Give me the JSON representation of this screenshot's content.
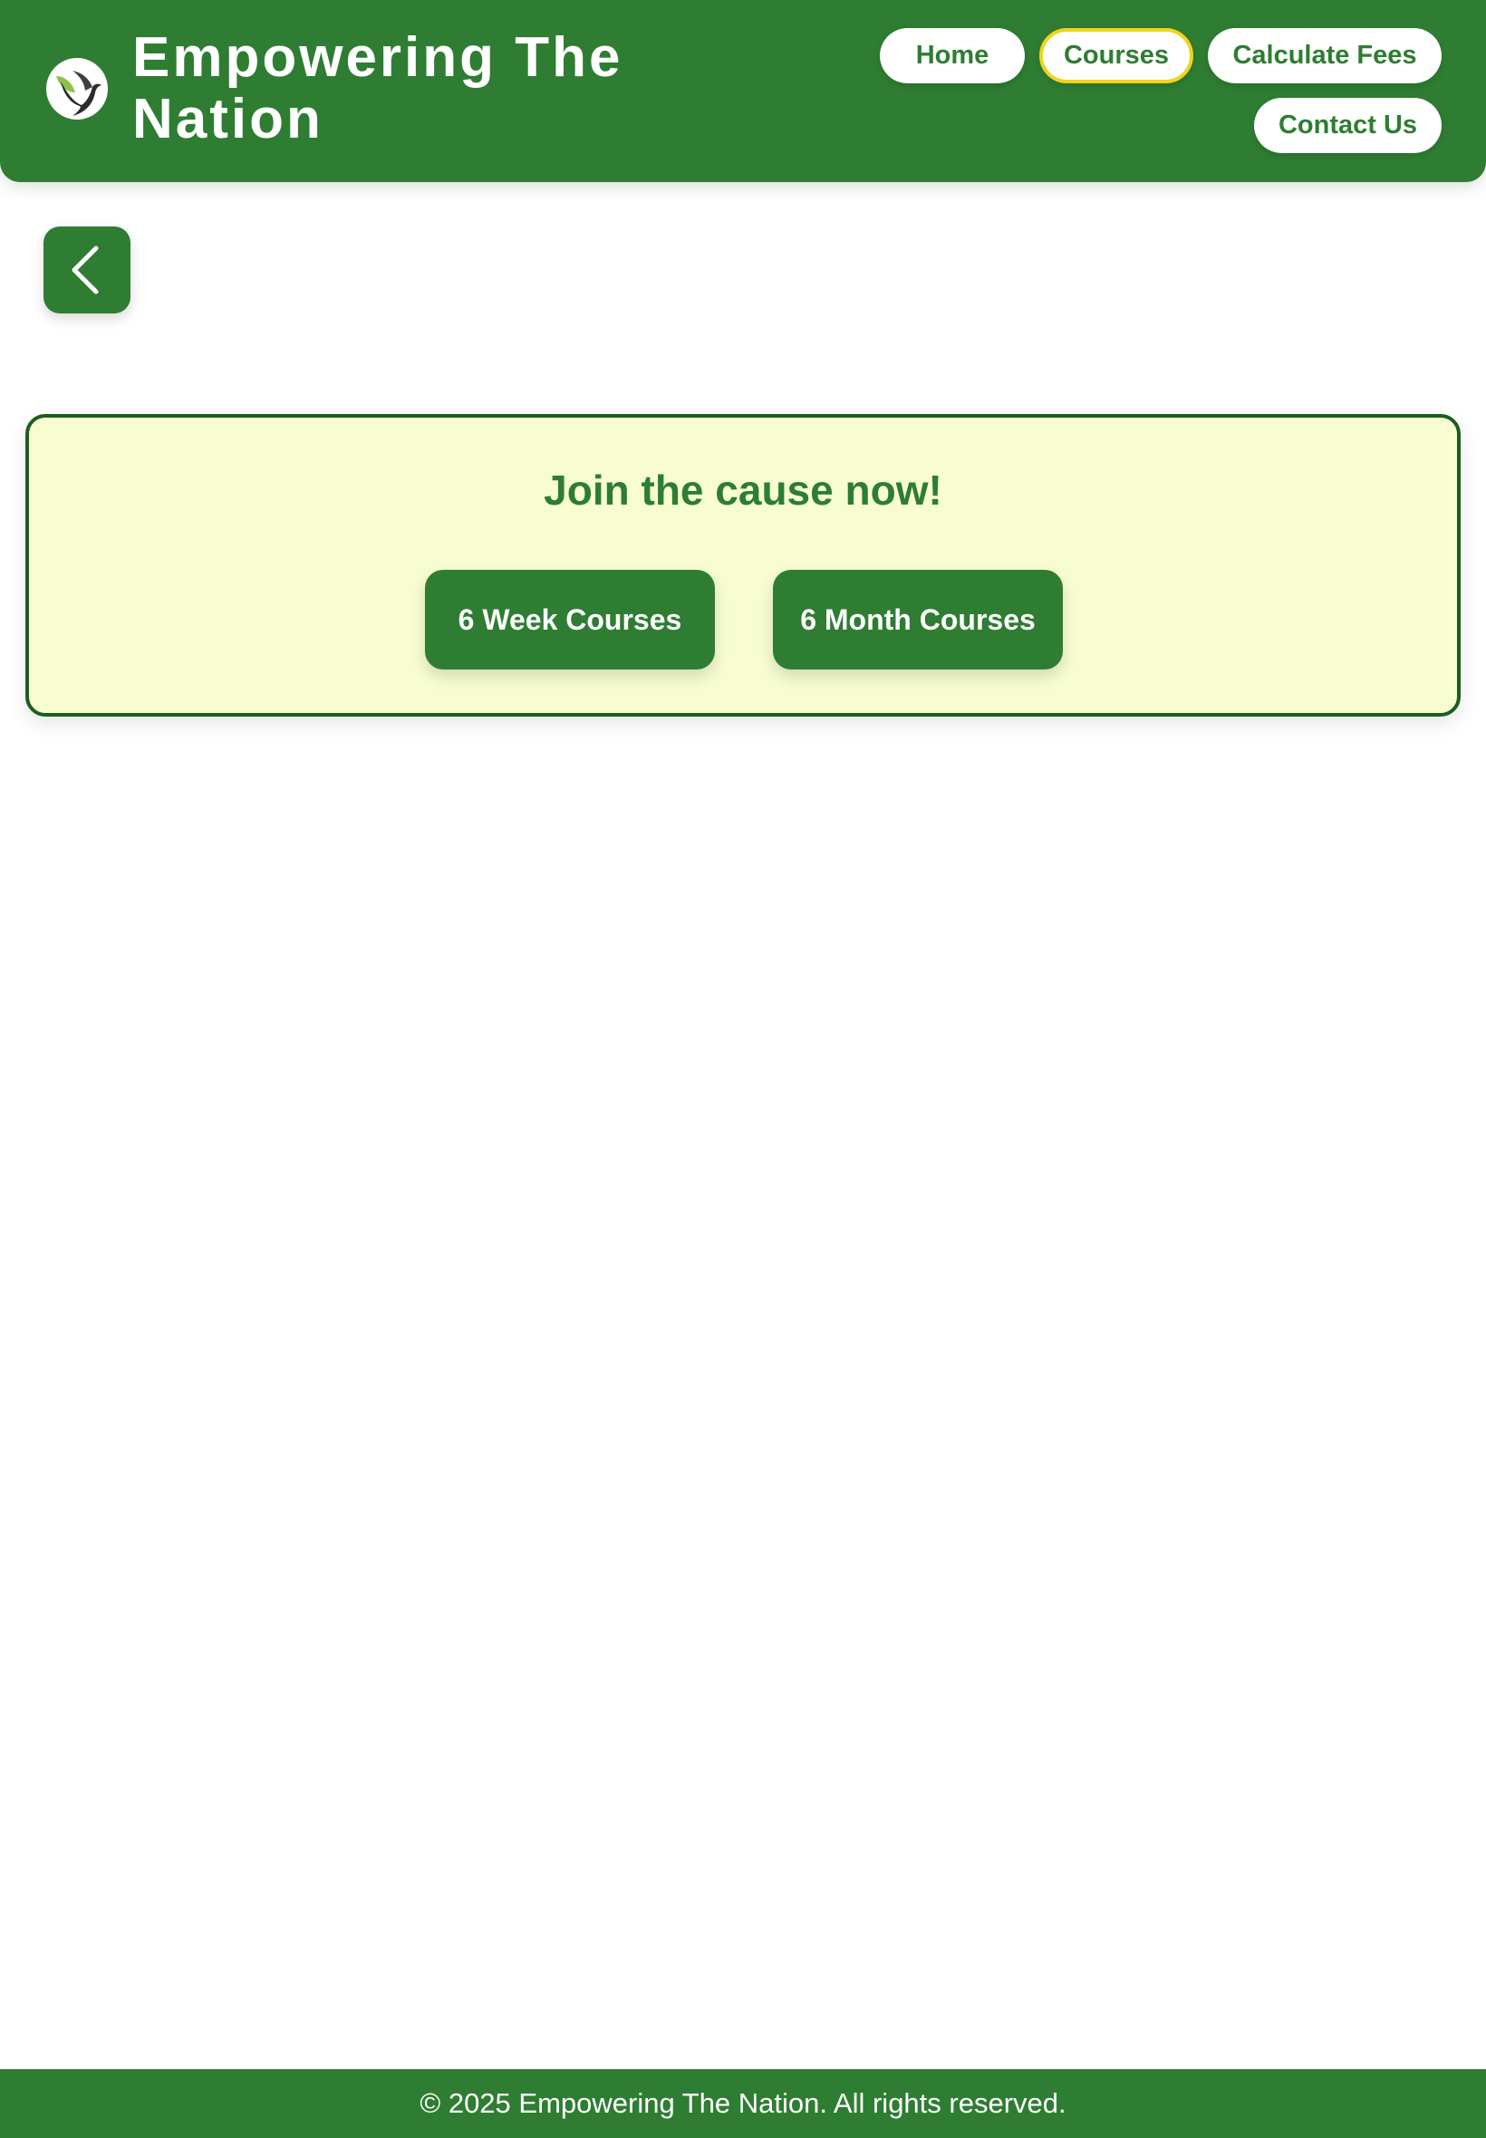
{
  "header": {
    "brand_title": "Empowering The Nation",
    "logo_icon": "dove-leaf-icon"
  },
  "nav": {
    "items": [
      {
        "label": "Home",
        "active": false
      },
      {
        "label": "Courses",
        "active": true
      },
      {
        "label": "Calculate Fees",
        "active": false
      },
      {
        "label": "Contact Us",
        "active": false
      }
    ]
  },
  "back_button": {
    "icon": "chevron-left-icon"
  },
  "cta": {
    "title": "Join the cause now!",
    "buttons": [
      {
        "label": "6 Week Courses"
      },
      {
        "label": "6 Month Courses"
      }
    ]
  },
  "footer": {
    "text": "© 2025 Empowering The Nation. All rights reserved."
  },
  "colors": {
    "primary_green": "#2e7d32",
    "dark_green_border": "#1b5e20",
    "cta_background": "#f7fdd1",
    "active_outline": "#f2d31b",
    "white": "#ffffff"
  }
}
